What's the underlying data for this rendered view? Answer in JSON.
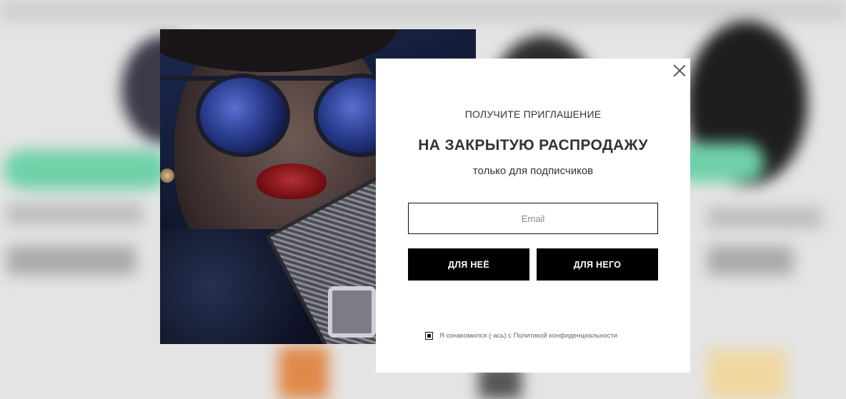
{
  "popup": {
    "kicker": "ПОЛУЧИТЕ ПРИГЛАШЕНИЕ",
    "headline": "НА ЗАКРЫТУЮ РАСПРОДАЖУ",
    "subline": "только для подписчиков",
    "email_placeholder": "Email",
    "email_value": "",
    "button_her": "ДЛЯ НЕЁ",
    "button_him": "ДЛЯ НЕГО",
    "consent_checked": true,
    "consent_text": "Я ознакомился (-ась) с Политикой конфиденциальности"
  },
  "icons": {
    "close": "close-icon",
    "checkbox": "checkbox-checked-icon"
  },
  "colors": {
    "button_bg": "#000000",
    "button_text": "#ffffff",
    "modal_bg": "#ffffff",
    "text": "#333333",
    "background_accent": "#6fd1a8"
  }
}
